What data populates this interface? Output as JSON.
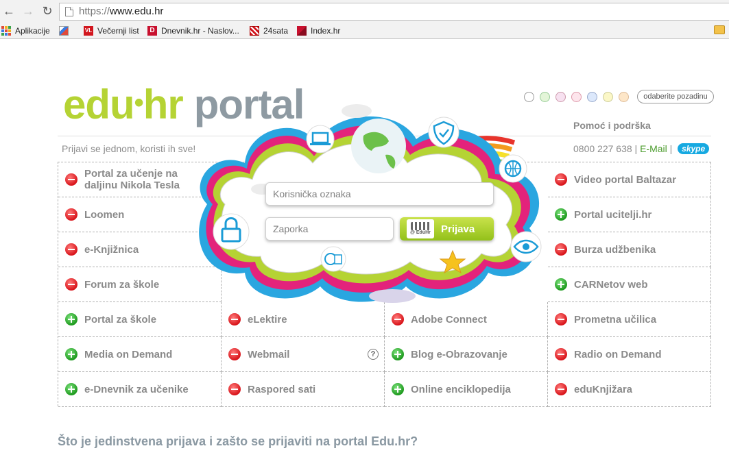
{
  "browser": {
    "url_scheme": "https://",
    "url_host": "www.edu.hr",
    "bookmarks": [
      {
        "label": "Aplikacije",
        "icon": "apps-grid-icon"
      },
      {
        "label": "",
        "icon": "bookmark-site-icon"
      },
      {
        "label": "Večernji list",
        "icon": "vecernji-list-icon",
        "icon_text": "VL"
      },
      {
        "label": "Dnevnik.hr - Naslov...",
        "icon": "dnevnik-icon",
        "icon_text": "D"
      },
      {
        "label": "24sata",
        "icon": "24sata-icon"
      },
      {
        "label": "Index.hr",
        "icon": "index-hr-icon"
      }
    ]
  },
  "header": {
    "logo_part1": "edu",
    "logo_dot": "•",
    "logo_part2": "hr",
    "logo_part3": "portal",
    "tagline": "Prijavi se jednom, koristi ih sve!",
    "background_picker_label": "odaberite pozadinu",
    "background_colors": [
      "#ffffff",
      "#e3f5d8",
      "#f7e1f0",
      "#fde5ec",
      "#dce8fb",
      "#fbf7c7",
      "#fde6c8"
    ]
  },
  "support": {
    "title": "Pomoć i podrška",
    "phone": "0800 227 638",
    "separator": "|",
    "email_label": "E-Mail",
    "skype_label": "skype"
  },
  "login": {
    "username_placeholder": "Korisnička oznaka",
    "password_placeholder": "Zaporka",
    "submit_label": "Prijava",
    "submit_logo_text": "@ EduHr"
  },
  "services": [
    {
      "label": "Portal za učenje na daljinu Nikola Tesla",
      "status": "minus"
    },
    {
      "label": "Video portal Baltazar",
      "status": "minus"
    },
    {
      "label": "Loomen",
      "status": "minus"
    },
    {
      "label": "Portal ucitelji.hr",
      "status": "plus"
    },
    {
      "label": "e-Knjižnica",
      "status": "minus"
    },
    {
      "label": "Burza udžbenika",
      "status": "minus"
    },
    {
      "label": "Forum za škole",
      "status": "minus"
    },
    {
      "label": "CARNetov web",
      "status": "plus"
    },
    {
      "label": "Portal za škole",
      "status": "plus"
    },
    {
      "label": "eLektire",
      "status": "minus"
    },
    {
      "label": "Adobe Connect",
      "status": "minus"
    },
    {
      "label": "Prometna učilica",
      "status": "minus"
    },
    {
      "label": "Media on Demand",
      "status": "plus"
    },
    {
      "label": "Webmail",
      "status": "minus"
    },
    {
      "label": "Blog e-Obrazovanje",
      "status": "plus"
    },
    {
      "label": "Radio on Demand",
      "status": "minus"
    },
    {
      "label": "e-Dnevnik za učenike",
      "status": "plus"
    },
    {
      "label": "Raspored sati",
      "status": "minus"
    },
    {
      "label": "Online enciklopedija",
      "status": "plus"
    },
    {
      "label": "eduKnjižara",
      "status": "minus"
    }
  ],
  "webmail_help": "?",
  "footer_question": "Što je jedinstvena prijava i zašto se prijaviti na portal Edu.hr?"
}
